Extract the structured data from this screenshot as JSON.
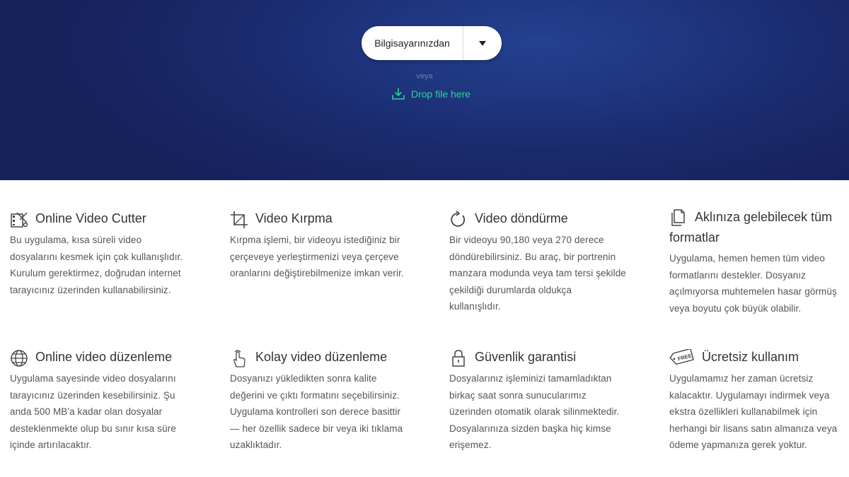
{
  "upload": {
    "button_label": "Bilgisayarınızdan",
    "or_text": "veya",
    "drop_label": "Drop file here"
  },
  "features": [
    {
      "title": "Online Video Cutter",
      "icon": "film-scissors-icon",
      "lines": [
        "Bu uygulama, kısa süreli video",
        "dosyalarını kesmek için çok kullanışlıdır.",
        "Kurulum gerektirmez, doğrudan internet",
        "tarayıcınız üzerinden kullanabilirsiniz."
      ]
    },
    {
      "title": "Video Kırpma",
      "icon": "crop-icon",
      "lines": [
        "Kırpma işlemi, bir videoyu istediğiniz bir",
        "çerçeveye yerleştirmenizi veya çerçeve",
        "oranlarını değiştirebilmenize imkan verir."
      ]
    },
    {
      "title": "Video döndürme",
      "icon": "rotate-icon",
      "lines": [
        "Bir videoyu 90,180 veya 270 derece",
        "döndürebilirsiniz. Bu araç, bir portrenin",
        "manzara modunda veya tam tersi şekilde",
        "çekildiği durumlarda oldukça",
        "kullanışlıdır."
      ]
    },
    {
      "title_lines": [
        "Aklınıza gelebilecek tüm",
        "formatlar"
      ],
      "icon": "files-icon",
      "lines": [
        "Uygulama, hemen hemen tüm video",
        "formatlarını destekler. Dosyanız",
        "açılmıyorsa muhtemelen hasar görmüş",
        "veya boyutu çok büyük olabilir."
      ]
    },
    {
      "title": "Online video düzenleme",
      "icon": "globe-icon",
      "lines": [
        "Uygulama sayesinde video dosyalarını",
        "tarayıcınız üzerinden kesebilirsiniz. Şu",
        "anda 500 MB'a kadar olan dosyalar",
        "desteklenmekte olup bu sınır kısa süre",
        "içinde artırılacaktır."
      ]
    },
    {
      "title": "Kolay video düzenleme",
      "icon": "hand-pointer-icon",
      "lines": [
        "Dosyanızı yükledikten sonra kalite",
        "değerini ve çıktı formatını seçebilirsiniz.",
        "Uygulama kontrolleri son derece basittir",
        "— her özellik sadece bir veya iki tıklama",
        "uzaklıktadır."
      ]
    },
    {
      "title": "Güvenlik garantisi",
      "icon": "lock-icon",
      "lines": [
        "Dosyalarınız işleminizi tamamladıktan",
        "birkaç saat sonra sunucularımız",
        "üzerinden otomatik olarak silinmektedir.",
        "Dosyalarınıza sizden başka hiç kimse",
        "erişemez."
      ]
    },
    {
      "title": "Ücretsiz kullanım",
      "icon": "free-tag-icon",
      "icon_text": "FREE",
      "lines": [
        "Uygulamamız her zaman ücretsiz",
        "kalacaktır. Uygulamayı indirmek veya",
        "ekstra özellikleri kullanabilmek için",
        "herhangi bir lisans satın almanıza veya",
        "ödeme yapmanıza gerek yoktur."
      ]
    }
  ]
}
